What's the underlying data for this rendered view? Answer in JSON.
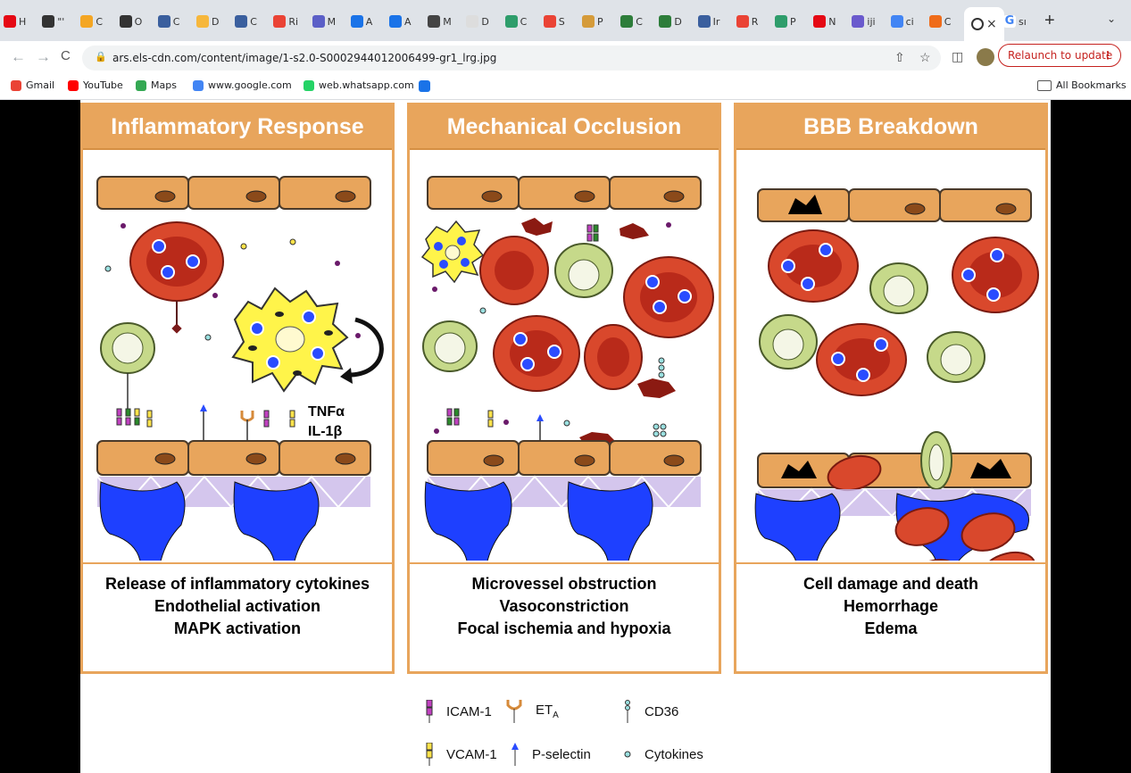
{
  "browser": {
    "tabs": [
      {
        "label": "H",
        "color": "#e50914"
      },
      {
        "label": "\"'",
        "color": "#333"
      },
      {
        "label": "C",
        "color": "#f4a623"
      },
      {
        "label": "O",
        "color": "#333"
      },
      {
        "label": "C",
        "color": "#3a5f9e"
      },
      {
        "label": "D",
        "color": "#f6b73c"
      },
      {
        "label": "C",
        "color": "#3a5f9e"
      },
      {
        "label": "Ri",
        "color": "#ea4335"
      },
      {
        "label": "M",
        "color": "#5b5fc7"
      },
      {
        "label": "A",
        "color": "#1a73e8"
      },
      {
        "label": "A",
        "color": "#1a73e8"
      },
      {
        "label": "M",
        "color": "#444"
      },
      {
        "label": "D",
        "color": "#ddd"
      },
      {
        "label": "C",
        "color": "#2e9d6b"
      },
      {
        "label": "S",
        "color": "#ea4335"
      },
      {
        "label": "P",
        "color": "#d59b3a"
      },
      {
        "label": "C",
        "color": "#2d7d3a"
      },
      {
        "label": "D",
        "color": "#2d7d3a"
      },
      {
        "label": "Ir",
        "color": "#3a5f9e"
      },
      {
        "label": "R",
        "color": "#ea4335"
      },
      {
        "label": "P",
        "color": "#2e9d6b"
      },
      {
        "label": "N",
        "color": "#e50914"
      },
      {
        "label": "iji",
        "color": "#6a5acd"
      },
      {
        "label": "ci",
        "color": "#4285f4"
      },
      {
        "label": "C",
        "color": "#ef6c1a"
      }
    ],
    "active_tab": {
      "close": "×"
    },
    "last_tab": {
      "label": "sı"
    },
    "new_tab": "+",
    "tab_menu": "⌄",
    "back": "←",
    "forward": "→",
    "reload": "C",
    "url": "ars.els-cdn.com/content/image/1-s2.0-S0002944012006499-gr1_lrg.jpg",
    "relaunch": "Relaunch to update",
    "bookmarks": [
      {
        "label": "Gmail",
        "icon": "gmail-icon",
        "color": "#ea4335"
      },
      {
        "label": "YouTube",
        "icon": "youtube-icon",
        "color": "#ff0000"
      },
      {
        "label": "Maps",
        "icon": "maps-icon",
        "color": "#34a853"
      },
      {
        "label": "www.google.com",
        "icon": "google-icon",
        "color": "#4285f4"
      },
      {
        "label": "web.whatsapp.com",
        "icon": "whatsapp-icon",
        "color": "#25d366"
      }
    ],
    "all_bookmarks": "All Bookmarks"
  },
  "figure": {
    "panels": [
      {
        "title": "Inflammatory Response",
        "lines": [
          "Release of inflammatory cytokines",
          "Endothelial activation",
          "MAPK activation"
        ]
      },
      {
        "title": "Mechanical Occlusion",
        "lines": [
          "Microvessel obstruction",
          "Vasoconstriction",
          "Focal ischemia and hypoxia"
        ]
      },
      {
        "title": "BBB Breakdown",
        "lines": [
          "Cell damage and death",
          "Hemorrhage",
          "Edema"
        ]
      }
    ],
    "cytokine_label_1": "TNFα",
    "cytokine_label_2": "IL-1β",
    "legend": {
      "icam": "ICAM-1",
      "vcam": "VCAM-1",
      "eta": "ET",
      "eta_sub": "A",
      "psel": "P-selectin",
      "cd36": "CD36",
      "cytokines": "Cytokines"
    },
    "colors": {
      "panel_border": "#e8a55c",
      "endothelium": "#e8a55c",
      "rbc": "#d9482c",
      "wbc": "#c6d98a",
      "astrocyte": "#1e40ff",
      "platelet": "#8b1a12"
    }
  }
}
